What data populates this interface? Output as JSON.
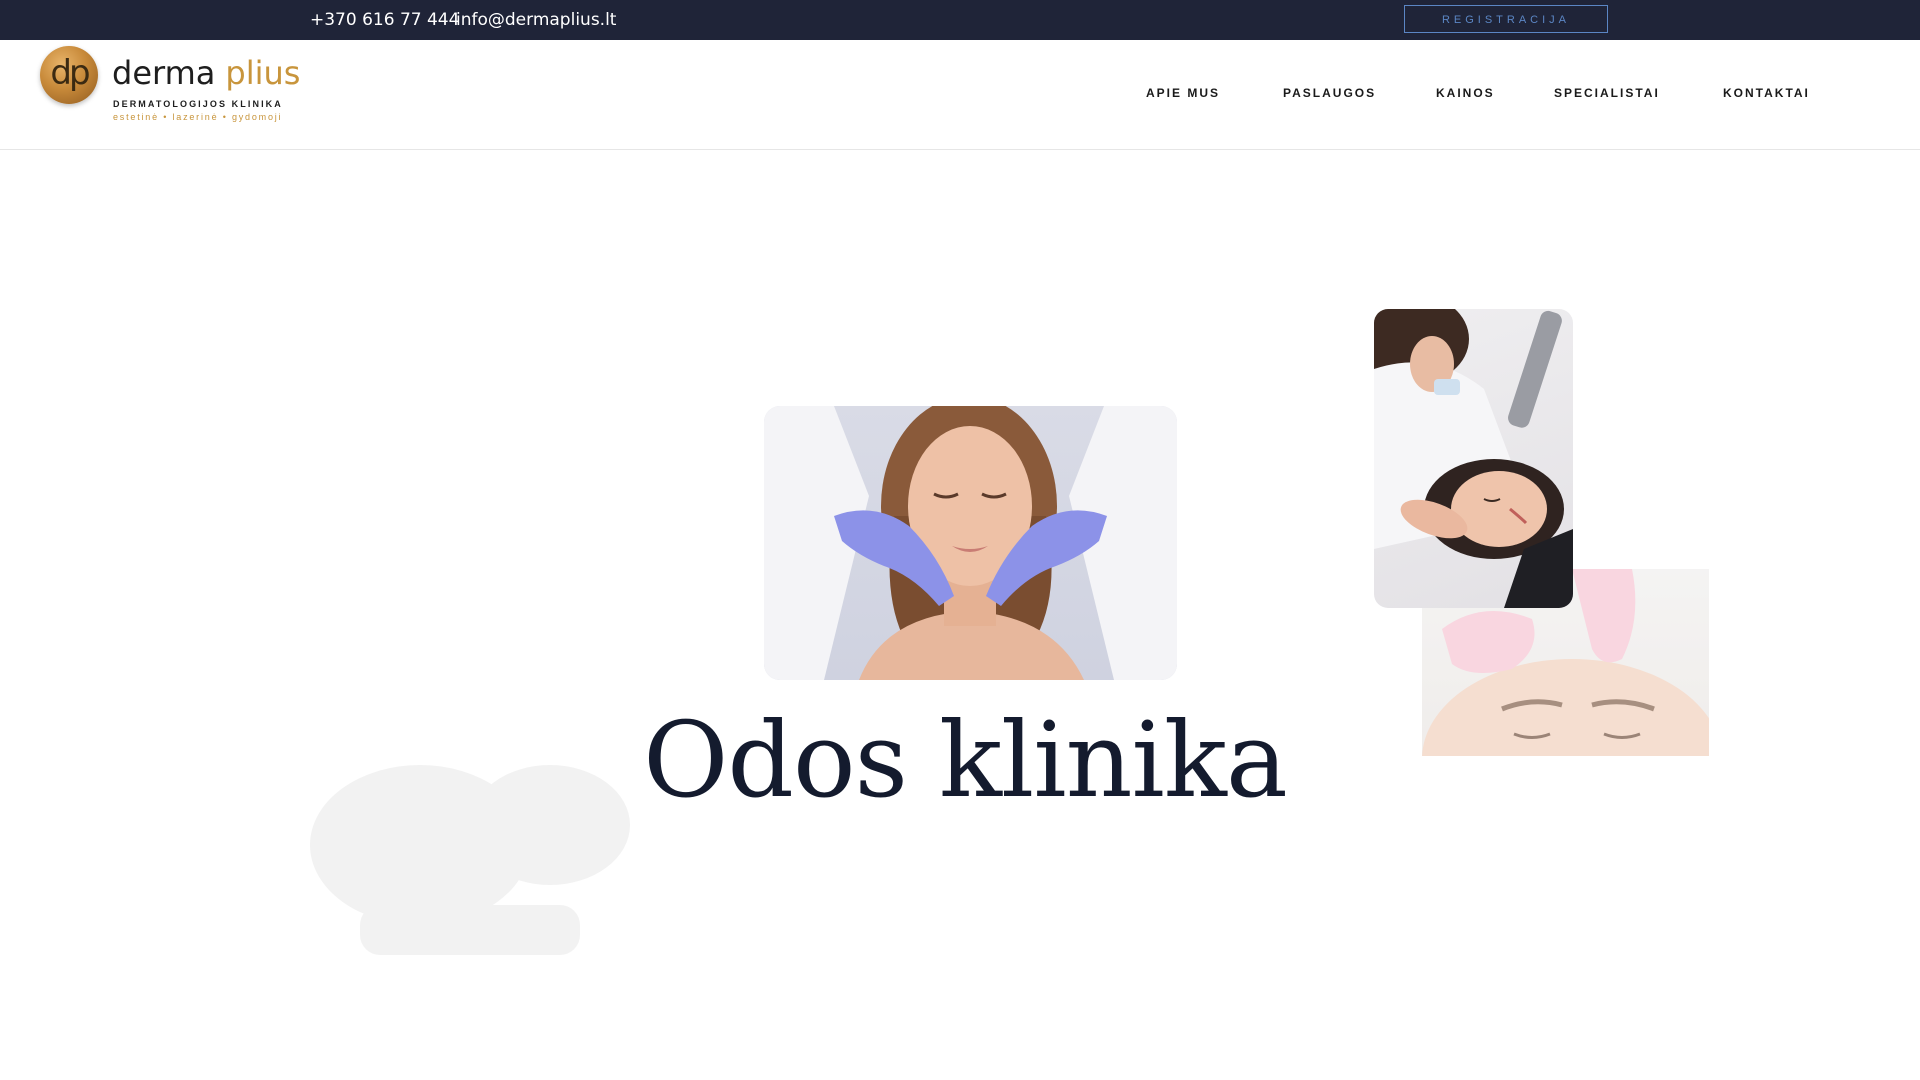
{
  "topbar": {
    "phone": "+370 616 77 444",
    "email": "info@dermaplius.lt",
    "register_label": "REGISTRACIJA"
  },
  "logo": {
    "monogram": "dp",
    "word_main": "derma",
    "word_accent": "plius",
    "subtitle": "DERMATOLOGIJOS KLINIKA",
    "tagline": "estetinė • lazerinė • gydomoji"
  },
  "nav": {
    "items": [
      {
        "label": "APIE MUS"
      },
      {
        "label": "PASLAUGOS"
      },
      {
        "label": "KAINOS"
      },
      {
        "label": "SPECIALISTAI"
      },
      {
        "label": "KONTAKTAI"
      }
    ]
  },
  "hero": {
    "title": "Odos klinika"
  },
  "colors": {
    "topbar_bg": "#1f2438",
    "accent_gold": "#c8953c",
    "button_blue": "#5b86c4",
    "title_navy": "#141b2e"
  }
}
